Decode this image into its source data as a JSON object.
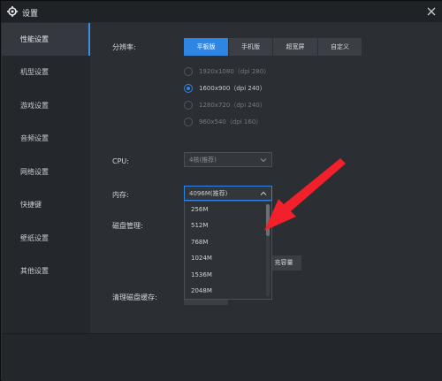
{
  "window": {
    "title": "设置"
  },
  "sidebar": {
    "items": [
      {
        "label": "性能设置",
        "active": true
      },
      {
        "label": "机型设置"
      },
      {
        "label": "游戏设置"
      },
      {
        "label": "音频设置"
      },
      {
        "label": "网络设置"
      },
      {
        "label": "快捷键"
      },
      {
        "label": "壁纸设置"
      },
      {
        "label": "其他设置"
      }
    ]
  },
  "performance": {
    "resolution_label": "分辨率:",
    "resolution_tabs": [
      "平板版",
      "手机版",
      "超宽屏",
      "自定义"
    ],
    "resolution_options": [
      {
        "label": "1920x1080（dpi 280）",
        "selected": false
      },
      {
        "label": "1600x900（dpi 240）",
        "selected": true
      },
      {
        "label": "1280x720（dpi 240）",
        "selected": false
      },
      {
        "label": "960x540（dpi 160）",
        "selected": false
      }
    ],
    "cpu_label": "CPU:",
    "cpu_value": "4核(推荐)",
    "memory_label": "内存:",
    "memory_value": "4096M(推荐)",
    "memory_options": [
      "256M",
      "512M",
      "768M",
      "1024M",
      "1536M",
      "2048M"
    ],
    "disk_label": "磁盘管理:",
    "expand_button": "充容量",
    "clear_cache_label": "清理磁盘缓存:"
  },
  "colors": {
    "accent": "#2f85e3",
    "annotation_arrow": "#f2202a"
  }
}
